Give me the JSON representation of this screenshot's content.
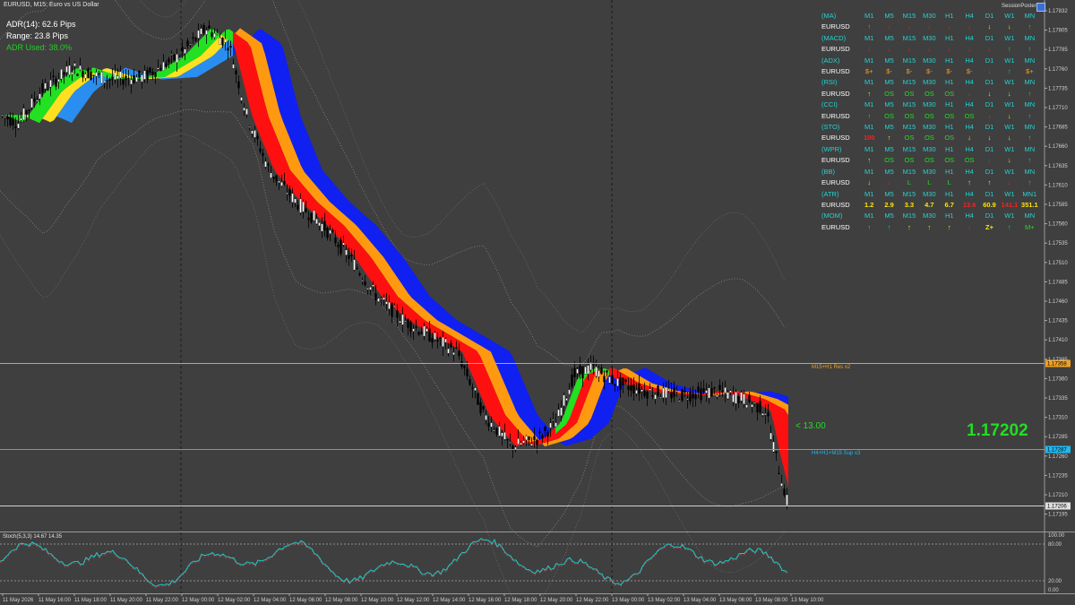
{
  "window": {
    "symbol_title": "EURUSD, M15: Euro vs US Dollar",
    "session_poster": "SessionPoster"
  },
  "adr_panel": {
    "adr": "ADR(14): 62.6 Pips",
    "range": "Range: 23.8 Pips",
    "adr_used": "ADR Used: 38.0%"
  },
  "price": {
    "current": "1.17202",
    "pips_to_sup": "< 13.00"
  },
  "levels": [
    {
      "label": "M15+H1 Res x2",
      "tag": "1.17358",
      "price": 1.17358,
      "color": "#f0a020"
    },
    {
      "label": "H4+H1+M15 Sup x3",
      "tag": "1.17287",
      "price": 1.17287,
      "color": "#22b8f0"
    },
    {
      "label": "",
      "tag": "1.17206",
      "price": 1.17206,
      "color": "#d0d0d0"
    }
  ],
  "price_axis": {
    "ticks": [
      "1.17825",
      "1.17800",
      "1.17775",
      "1.17750",
      "1.17725",
      "1.17700",
      "1.17675",
      "1.17650",
      "1.17625",
      "1.17600",
      "1.17575",
      "1.17550",
      "1.17525",
      "1.17500",
      "1.17475",
      "1.17450",
      "1.17425",
      "1.17400",
      "1.17375",
      "1.17350",
      "1.17325",
      "1.17300",
      "1.17275",
      "1.17250",
      "1.17225",
      "1.17200",
      "1.17175"
    ],
    "display_ticks": [
      "1.17832",
      "1.17805",
      "1.17785",
      "1.17760",
      "1.17735",
      "1.17710",
      "1.17685",
      "1.17660",
      "1.17635",
      "1.17610",
      "1.17585",
      "1.17560",
      "1.17535",
      "1.17510",
      "1.17485",
      "1.17460",
      "1.17435",
      "1.17410",
      "1.17385",
      "1.17360",
      "1.17335",
      "1.17310",
      "1.17285",
      "1.17260",
      "1.17235",
      "1.17210",
      "1.17195"
    ]
  },
  "time_axis": [
    "11 May 2026",
    "11 May 16:00",
    "11 May 18:00",
    "11 May 20:00",
    "11 May 22:00",
    "12 May 00:00",
    "12 May 02:00",
    "12 May 04:00",
    "12 May 06:00",
    "12 May 08:00",
    "12 May 10:00",
    "12 May 12:00",
    "12 May 14:00",
    "12 May 16:00",
    "12 May 18:00",
    "12 May 20:00",
    "12 May 22:00",
    "13 May 00:00",
    "13 May 02:00",
    "13 May 04:00",
    "13 May 06:00",
    "13 May 08:00",
    "13 May 10:00"
  ],
  "stochastic": {
    "label": "Stoch(5,3,3) 14.67 14.35",
    "levels": [
      "100.00",
      "80.00",
      "20.00",
      "0.00"
    ]
  },
  "dashboard": {
    "rows": [
      {
        "name": "(MA)",
        "type": "hdr",
        "cells": [
          "M1",
          "M5",
          "M15",
          "M30",
          "H1",
          "H4",
          "D1",
          "W1",
          "MN"
        ]
      },
      {
        "name": "EURUSD",
        "type": "sym",
        "cells": [
          {
            "v": "↑",
            "c": "green"
          },
          {
            "v": "↓",
            "c": "red"
          },
          {
            "v": "↓",
            "c": "red"
          },
          {
            "v": "↓",
            "c": "red"
          },
          {
            "v": "↓",
            "c": "red"
          },
          {
            "v": "↓",
            "c": "red"
          },
          {
            "v": "↓",
            "c": "yellow"
          },
          {
            "v": "↓",
            "c": "yellow"
          },
          {
            "v": "↑",
            "c": "green"
          }
        ]
      },
      {
        "name": "(MACD)",
        "type": "hdr",
        "cells": [
          "M1",
          "M5",
          "M15",
          "M30",
          "H1",
          "H4",
          "D1",
          "W1",
          "MN"
        ]
      },
      {
        "name": "EURUSD",
        "type": "sym",
        "cells": [
          {
            "v": "↓",
            "c": "red"
          },
          {
            "v": "↓",
            "c": "red"
          },
          {
            "v": "↓",
            "c": "red"
          },
          {
            "v": "↓",
            "c": "red"
          },
          {
            "v": "↓",
            "c": "red"
          },
          {
            "v": "↓",
            "c": "red"
          },
          {
            "v": "↓",
            "c": "red"
          },
          {
            "v": "↑",
            "c": "green"
          },
          {
            "v": "↑",
            "c": "green"
          }
        ]
      },
      {
        "name": "(ADX)",
        "type": "hdr",
        "cells": [
          "M1",
          "M5",
          "M15",
          "M30",
          "H1",
          "H4",
          "D1",
          "W1",
          "MN"
        ]
      },
      {
        "name": "EURUSD",
        "type": "sym",
        "cells": [
          {
            "v": "$+",
            "c": "orange"
          },
          {
            "v": "$-",
            "c": "orange"
          },
          {
            "v": "$-",
            "c": "orange"
          },
          {
            "v": "$-",
            "c": "orange"
          },
          {
            "v": "$-",
            "c": "orange"
          },
          {
            "v": "$-",
            "c": "orange"
          },
          {
            "v": "↓",
            "c": "red"
          },
          {
            "v": "↑",
            "c": "green"
          },
          {
            "v": "$+",
            "c": "orange"
          }
        ]
      },
      {
        "name": "(RSI)",
        "type": "hdr",
        "cells": [
          "M1",
          "M5",
          "M15",
          "M30",
          "H1",
          "H4",
          "D1",
          "W1",
          "MN"
        ]
      },
      {
        "name": "EURUSD",
        "type": "sym",
        "cells": [
          {
            "v": "↑",
            "c": "yellow"
          },
          {
            "v": "OS",
            "c": "lgreen"
          },
          {
            "v": "OS",
            "c": "lgreen"
          },
          {
            "v": "OS",
            "c": "lgreen"
          },
          {
            "v": "OS",
            "c": "lgreen"
          },
          {
            "v": "↓",
            "c": "red"
          },
          {
            "v": "↓",
            "c": "yellow"
          },
          {
            "v": "↓",
            "c": "yellow"
          },
          {
            "v": "↑",
            "c": "green"
          }
        ]
      },
      {
        "name": "(CCI)",
        "type": "hdr",
        "cells": [
          "M1",
          "M5",
          "M15",
          "M30",
          "H1",
          "H4",
          "D1",
          "W1",
          "MN"
        ]
      },
      {
        "name": "EURUSD",
        "type": "sym",
        "cells": [
          {
            "v": "↑",
            "c": "green"
          },
          {
            "v": "OS",
            "c": "lgreen"
          },
          {
            "v": "OS",
            "c": "lgreen"
          },
          {
            "v": "OS",
            "c": "lgreen"
          },
          {
            "v": "OS",
            "c": "lgreen"
          },
          {
            "v": "OS",
            "c": "lgreen"
          },
          {
            "v": "↓",
            "c": "red"
          },
          {
            "v": "↓",
            "c": "yellow"
          },
          {
            "v": "↑",
            "c": "green"
          }
        ]
      },
      {
        "name": "(STO)",
        "type": "hdr",
        "cells": [
          "M1",
          "M5",
          "M15",
          "M30",
          "H1",
          "H4",
          "D1",
          "W1",
          "MN"
        ]
      },
      {
        "name": "EURUSD",
        "type": "sym",
        "cells": [
          {
            "v": "100",
            "c": "red"
          },
          {
            "v": "↑",
            "c": "yellow"
          },
          {
            "v": "OS",
            "c": "lgreen"
          },
          {
            "v": "OS",
            "c": "lgreen"
          },
          {
            "v": "OS",
            "c": "lgreen"
          },
          {
            "v": "↓",
            "c": "yellow"
          },
          {
            "v": "↓",
            "c": "yellow"
          },
          {
            "v": "↓",
            "c": "yellow"
          },
          {
            "v": "↑",
            "c": "green"
          }
        ]
      },
      {
        "name": "(WPR)",
        "type": "hdr",
        "cells": [
          "M1",
          "M5",
          "M15",
          "M30",
          "H1",
          "H4",
          "D1",
          "W1",
          "MN"
        ]
      },
      {
        "name": "EURUSD",
        "type": "sym",
        "cells": [
          {
            "v": "↑",
            "c": "yellow"
          },
          {
            "v": "OS",
            "c": "lgreen"
          },
          {
            "v": "OS",
            "c": "lgreen"
          },
          {
            "v": "OS",
            "c": "lgreen"
          },
          {
            "v": "OS",
            "c": "lgreen"
          },
          {
            "v": "OS",
            "c": "lgreen"
          },
          {
            "v": "↓",
            "c": "red"
          },
          {
            "v": "↓",
            "c": "yellow"
          },
          {
            "v": "↑",
            "c": "green"
          }
        ]
      },
      {
        "name": "(BB)",
        "type": "hdr",
        "cells": [
          "M1",
          "M5",
          "M15",
          "M30",
          "H1",
          "H4",
          "D1",
          "W1",
          "MN"
        ]
      },
      {
        "name": "EURUSD",
        "type": "sym",
        "cells": [
          {
            "v": "↓",
            "c": "yellow"
          },
          {
            "v": "↓",
            "c": "red"
          },
          {
            "v": "L",
            "c": "lgreen"
          },
          {
            "v": "L",
            "c": "lgreen"
          },
          {
            "v": "L",
            "c": "lgreen"
          },
          {
            "v": "↑",
            "c": "yellow"
          },
          {
            "v": "↑",
            "c": "yellow"
          },
          {
            "v": "↓",
            "c": "red"
          },
          {
            "v": "↑",
            "c": "green"
          }
        ]
      },
      {
        "name": "(ATR)",
        "type": "hdr",
        "cells": [
          "M1",
          "M5",
          "M15",
          "M30",
          "H1",
          "H4",
          "D1",
          "W1",
          "MN1"
        ]
      },
      {
        "name": "EURUSD",
        "type": "sym",
        "cells": [
          {
            "v": "1.2",
            "c": "yellow"
          },
          {
            "v": "2.9",
            "c": "yellow"
          },
          {
            "v": "3.3",
            "c": "yellow"
          },
          {
            "v": "4.7",
            "c": "yellow"
          },
          {
            "v": "6.7",
            "c": "yellow"
          },
          {
            "v": "13.6",
            "c": "red"
          },
          {
            "v": "60.9",
            "c": "yellow"
          },
          {
            "v": "141.1",
            "c": "red"
          },
          {
            "v": "351.1",
            "c": "yellow"
          }
        ]
      },
      {
        "name": "(MOM)",
        "type": "hdr",
        "cells": [
          "M1",
          "M5",
          "M15",
          "M30",
          "H1",
          "H4",
          "D1",
          "W1",
          "MN"
        ]
      },
      {
        "name": "EURUSD",
        "type": "sym",
        "cells": [
          {
            "v": "↑",
            "c": "green"
          },
          {
            "v": "↑",
            "c": "green"
          },
          {
            "v": "↑",
            "c": "yellow"
          },
          {
            "v": "↑",
            "c": "yellow"
          },
          {
            "v": "↑",
            "c": "yellow"
          },
          {
            "v": "↓",
            "c": "red"
          },
          {
            "v": "Z+",
            "c": "yellow"
          },
          {
            "v": "↑",
            "c": "green"
          },
          {
            "v": "M+",
            "c": "lgreen"
          }
        ]
      }
    ]
  },
  "colors": {
    "background": "#3f3f3f",
    "up_candle": "#ffffff",
    "down_candle": "#000000",
    "band_blue": "#1020f0",
    "band_orange": "#ff9a10",
    "band_red": "#ff1010",
    "band_green": "#22e022",
    "band_yellow": "#ffe020",
    "band_lightblue": "#2a8ef0",
    "stoch_line": "#20c8c8"
  }
}
